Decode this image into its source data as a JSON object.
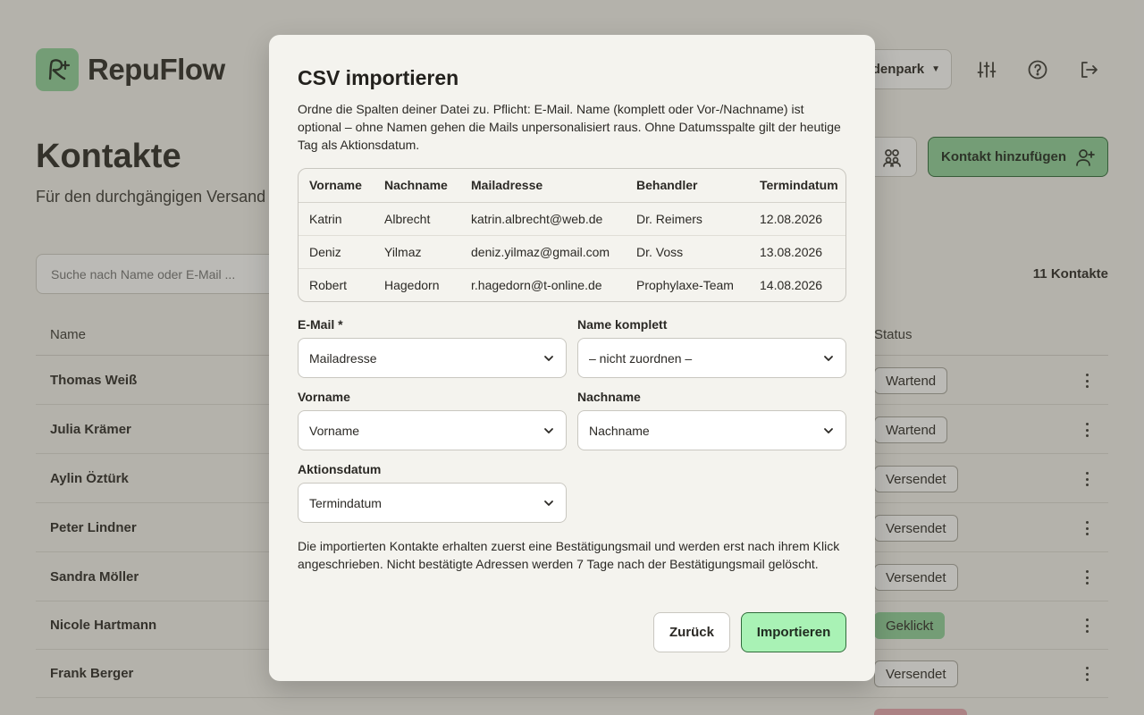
{
  "app": {
    "brand": "RepuFlow"
  },
  "header": {
    "location_label": "denpark"
  },
  "page": {
    "title": "Kontakte",
    "subtitle": "Für den durchgängigen Versand Kontakte benötigt.",
    "add_contact_label": "Kontakt hinzufügen",
    "search_placeholder": "Suche nach Name oder E-Mail ...",
    "count_label": "11 Kontakte"
  },
  "contacts_table": {
    "col_name": "Name",
    "col_status": "Status",
    "rows": [
      {
        "name": "Thomas Weiß",
        "status": "Wartend"
      },
      {
        "name": "Julia Krämer",
        "status": "Wartend"
      },
      {
        "name": "Aylin Öztürk",
        "status": "Versendet"
      },
      {
        "name": "Peter Lindner",
        "status": "Versendet"
      },
      {
        "name": "Sandra Möller",
        "status": "Versendet"
      },
      {
        "name": "Nicole Hartmann",
        "status": "Geklickt"
      },
      {
        "name": "Frank Berger",
        "status": "Versendet"
      }
    ]
  },
  "modal": {
    "title": "CSV importieren",
    "description": "Ordne die Spalten deiner Datei zu. Pflicht: E-Mail. Name (komplett oder Vor-/Nachname) ist optional – ohne Namen gehen die Mails unpersonalisiert raus. Ohne Datumsspalte gilt der heutige Tag als Aktionsdatum.",
    "preview": {
      "headers": [
        "Vorname",
        "Nachname",
        "Mailadresse",
        "Behandler",
        "Termindatum"
      ],
      "rows": [
        [
          "Katrin",
          "Albrecht",
          "katrin.albrecht@web.de",
          "Dr. Reimers",
          "12.08.2026"
        ],
        [
          "Deniz",
          "Yilmaz",
          "deniz.yilmaz@gmail.com",
          "Dr. Voss",
          "13.08.2026"
        ],
        [
          "Robert",
          "Hagedorn",
          "r.hagedorn@t-online.de",
          "Prophylaxe-Team",
          "14.08.2026"
        ]
      ]
    },
    "fields": {
      "email": {
        "label": "E-Mail *",
        "value": "Mailadresse"
      },
      "full_name": {
        "label": "Name komplett",
        "value": "– nicht zuordnen –"
      },
      "first_name": {
        "label": "Vorname",
        "value": "Vorname"
      },
      "last_name": {
        "label": "Nachname",
        "value": "Nachname"
      },
      "action_date": {
        "label": "Aktionsdatum",
        "value": "Termindatum"
      }
    },
    "note": "Die importierten Kontakte erhalten zuerst eine Bestätigungsmail und werden erst nach ihrem Klick angeschrieben. Nicht bestätigte Adressen werden 7 Tage nach der Bestätigungsmail gelöscht.",
    "back_label": "Zurück",
    "import_label": "Importieren"
  },
  "colors": {
    "accent_green": "#8fd19a",
    "import_green": "#a9f2b5",
    "background": "#f4f3ee"
  }
}
